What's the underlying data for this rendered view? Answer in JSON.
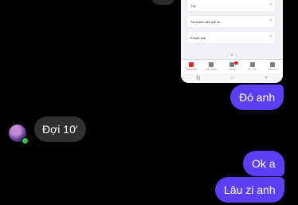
{
  "shared_image": {
    "rows": [
      {
        "label": "Thẻ"
      },
      {
        "label": "Tài khoản tiền gửi số"
      },
      {
        "label": "Khoản vay"
      }
    ],
    "tabs": [
      {
        "label": "Trang chủ",
        "active": true
      },
      {
        "label": "Sản phẩm",
        "active": false
      },
      {
        "label": "Ưu đãi",
        "active": false
      },
      {
        "label": "Đi - Tới",
        "active": false
      },
      {
        "label": "Tiện ích",
        "active": false
      }
    ],
    "nav": [
      "|||",
      "○",
      "<"
    ]
  },
  "messages": {
    "sent_1": "Đó anh",
    "received_1": "Đợi 10'",
    "sent_2": "Ok a",
    "sent_3": "Lâu zi anh"
  },
  "colors": {
    "sent_bubble": "#5b3ff2",
    "received_bubble": "#303030",
    "background": "#000000",
    "online_dot": "#31c44c"
  }
}
